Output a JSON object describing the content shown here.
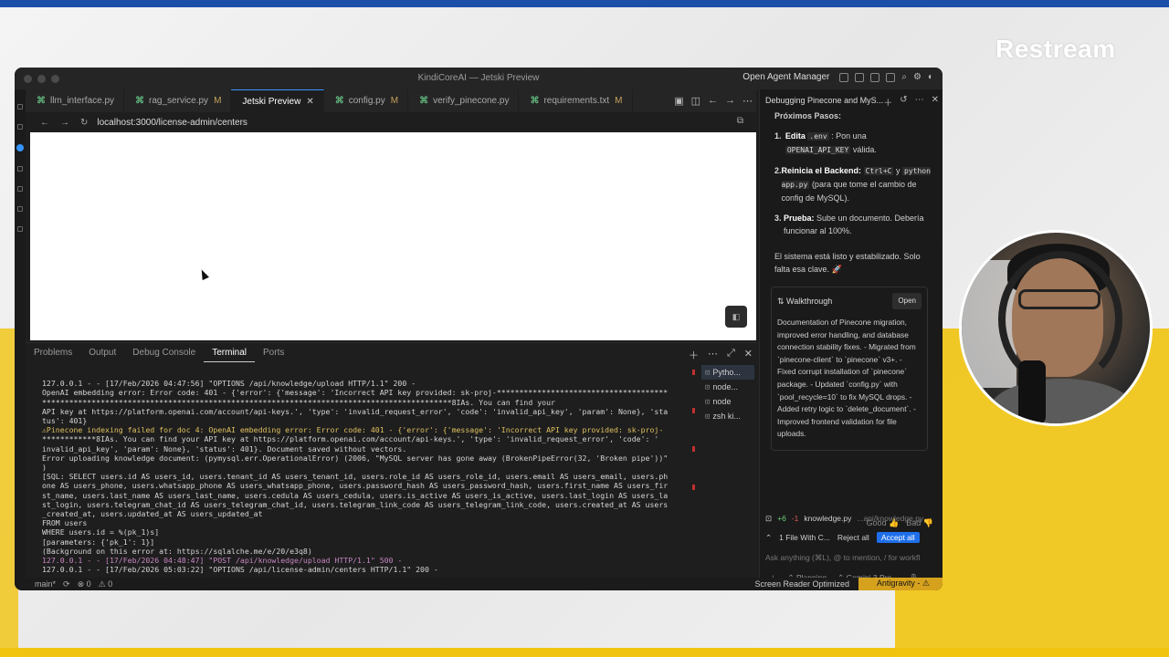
{
  "overlay": {
    "logo": "Restream"
  },
  "window": {
    "title": "KindiCoreAI — Jetski Preview",
    "open_agent_manager": "Open Agent Manager"
  },
  "tabs": [
    {
      "label": "llm_interface.py",
      "modified": ""
    },
    {
      "label": "rag_service.py",
      "modified": "M"
    },
    {
      "label": "Jetski Preview",
      "modified": "",
      "active": true
    },
    {
      "label": "config.py",
      "modified": "M"
    },
    {
      "label": "verify_pinecone.py",
      "modified": ""
    },
    {
      "label": "requirements.txt",
      "modified": "M"
    }
  ],
  "browser": {
    "url": "localhost:3000/license-admin/centers"
  },
  "panel": {
    "tabs": [
      "Problems",
      "Output",
      "Debug Console",
      "Terminal",
      "Ports"
    ],
    "active_tab": "Terminal",
    "terminals": [
      "Pytho...",
      "node...",
      "node",
      "zsh ki..."
    ]
  },
  "terminal_lines": [
    "127.0.0.1 - - [17/Feb/2026 04:47:56] \"OPTIONS /api/knowledge/upload HTTP/1.1\" 200 -",
    "OpenAI embedding error: Error code: 401 - {'error': {'message': 'Incorrect API key provided: sk-proj-**************************************",
    "*******************************************************************************************8IAs. You can find your",
    "API key at https://platform.openai.com/account/api-keys.', 'type': 'invalid_request_error', 'code': 'invalid_api_key', 'param': None}, 'sta",
    "tus': 401}",
    "⚠Pinecone indexing failed for doc 4: OpenAI embedding error: Error code: 401 - {'error': {'message': 'Incorrect API key provided: sk-proj-",
    "************8IAs. You can find your API key at https://platform.openai.com/account/api-keys.', 'type': 'invalid_request_error', 'code': '",
    "invalid_api_key', 'param': None}, 'status': 401}. Document saved without vectors.",
    "Error uploading knowledge document: (pymysql.err.OperationalError) (2006, \"MySQL server has gone away (BrokenPipeError(32, 'Broken pipe'))\"",
    ")",
    "[SQL: SELECT users.id AS users_id, users.tenant_id AS users_tenant_id, users.role_id AS users_role_id, users.email AS users_email, users.ph",
    "one AS users_phone, users.whatsapp_phone AS users_whatsapp_phone, users.password_hash AS users_password_hash, users.first_name AS users_fir",
    "st_name, users.last_name AS users_last_name, users.cedula AS users_cedula, users.is_active AS users_is_active, users.last_login AS users_la",
    "st_login, users.telegram_chat_id AS users_telegram_chat_id, users.telegram_link_code AS users_telegram_link_code, users.created_at AS users",
    "_created_at, users.updated_at AS users_updated_at",
    "FROM users",
    "WHERE users.id = %(pk_1)s]",
    "[parameters: {'pk_1': 1}]",
    "(Background on this error at: https://sqlalche.me/e/20/e3q8)",
    "127.0.0.1 - - [17/Feb/2026 04:48:47] \"POST /api/knowledge/upload HTTP/1.1\" 500 -",
    "127.0.0.1 - - [17/Feb/2026 05:03:22] \"OPTIONS /api/license-admin/centers HTTP/1.1\" 200 -"
  ],
  "agent": {
    "title": "Debugging Pinecone and MyS...",
    "heading": "Próximos Pasos:",
    "steps": [
      {
        "n": "1.",
        "bold": "Edita",
        "code": ".env",
        "rest": ": Pon una",
        "code2": "OPENAI_API_KEY",
        "rest2": "válida."
      },
      {
        "n": "2.",
        "bold": "Reinicia el Backend:",
        "code": "Ctrl+C",
        "rest": "y",
        "code2": "python app.py",
        "rest2": "(para que tome el cambio de config de MySQL)."
      },
      {
        "n": "3.",
        "bold": "Prueba:",
        "code": "",
        "rest": "Sube un documento. Debería funcionar al 100%.",
        "code2": "",
        "rest2": ""
      }
    ],
    "summary": "El sistema está listo y estabilizado. Solo falta esa clave. 🚀",
    "walkthrough": {
      "label": "Walkthrough",
      "open": "Open",
      "body": "Documentation of Pinecone migration, improved error handling, and database connection stability fixes. - Migrated from `pinecone-client` to `pinecone` v3+. - Fixed corrupt installation of `pinecone` package. - Updated `config.py` with `pool_recycle=10` to fix MySQL drops. - Added retry logic to `delete_document`. - Improved frontend validation for file uploads."
    },
    "feedback": {
      "good": "Good",
      "bad": "Bad"
    },
    "file": {
      "plus": "+6",
      "minus": "-1",
      "name": "knowledge.py",
      "path": "...api/knowledge.py"
    },
    "changes": {
      "label": "1 File With C...",
      "reject": "Reject all",
      "accept": "Accept all"
    },
    "ask_placeholder": "Ask anything (⌘L), @ to mention, / for workfl",
    "mode": "Planning",
    "model": "Gemini 3 Pro..."
  },
  "status": {
    "branch": "main*",
    "errors": "⊗ 0",
    "warnings": "⚠ 0",
    "screen_reader": "Screen Reader Optimized",
    "antigravity": "Antigravity - ⚠"
  }
}
